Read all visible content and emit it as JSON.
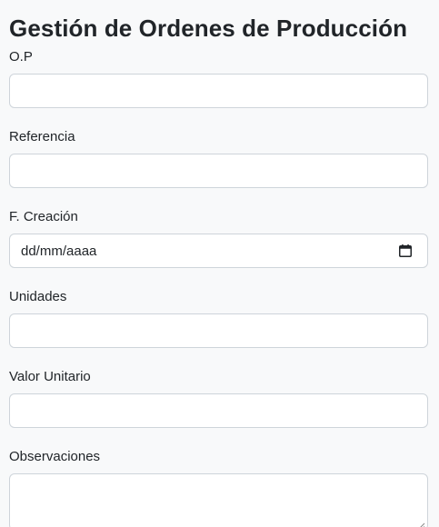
{
  "page": {
    "title": "Gestión de Ordenes de Producción"
  },
  "form": {
    "fields": [
      {
        "label": "O.P",
        "value": "",
        "placeholder": ""
      },
      {
        "label": "Referencia",
        "value": "",
        "placeholder": ""
      },
      {
        "label": "F. Creación",
        "value": "dd/mm/aaaa",
        "placeholder": ""
      },
      {
        "label": "Unidades",
        "value": "",
        "placeholder": ""
      },
      {
        "label": "Valor Unitario",
        "value": "",
        "placeholder": ""
      },
      {
        "label": "Observaciones",
        "value": "",
        "placeholder": ""
      }
    ]
  },
  "icons": {
    "date_picker": "calendar-icon",
    "textarea_resize": "resize-grip-icon"
  },
  "colors": {
    "background": "#f8f9fa",
    "input_border": "#ced4da",
    "text": "#212529"
  }
}
